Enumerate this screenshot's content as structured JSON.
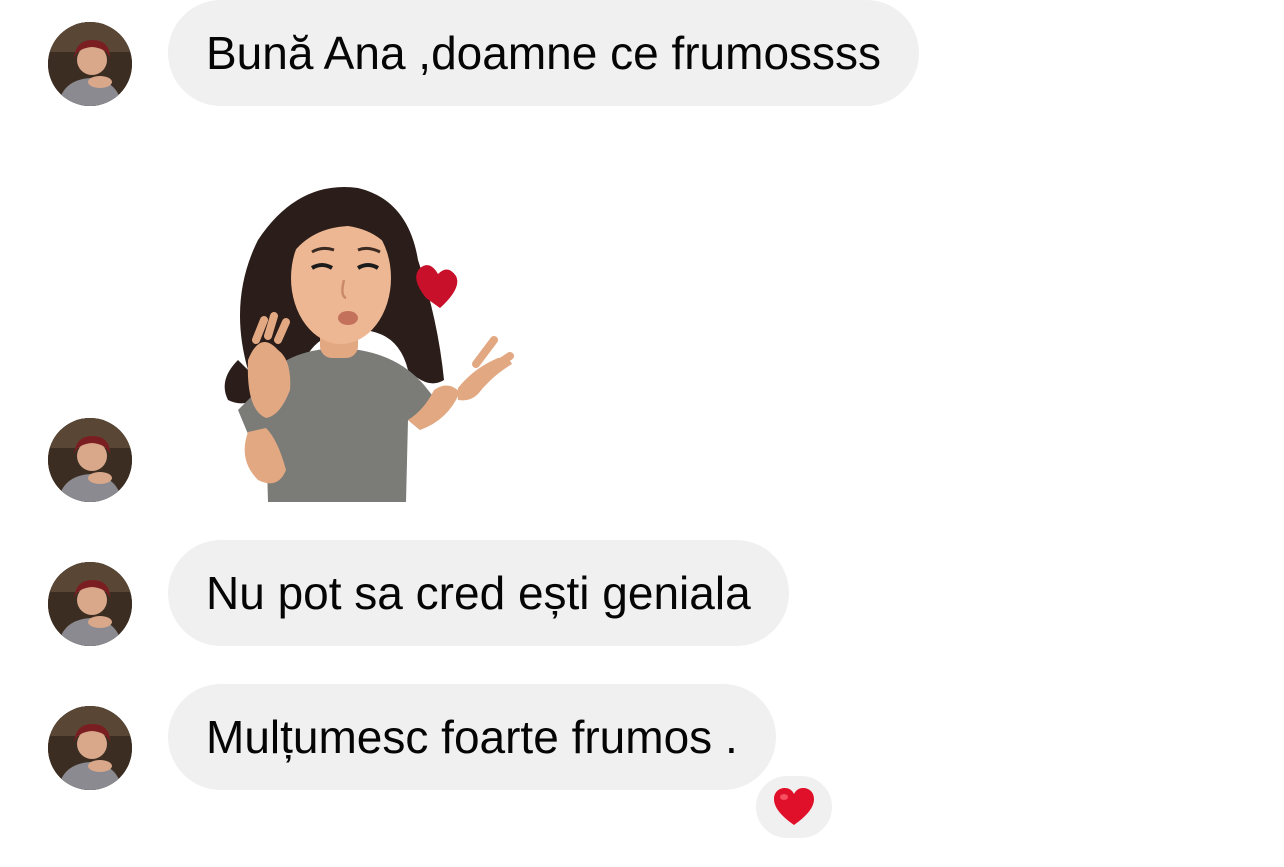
{
  "messages": [
    {
      "type": "text",
      "text": "Bună Ana ,doamne ce frumossss"
    },
    {
      "type": "sticker",
      "sticker": "avatar-blowing-kiss-sticker"
    },
    {
      "type": "text",
      "text": "Nu pot sa cred ești geniala"
    },
    {
      "type": "text",
      "text": "Mulțumesc foarte frumos .",
      "reaction": "heart"
    }
  ],
  "colors": {
    "bubble_background": "#f0f0f0",
    "text": "#050505",
    "reaction_heart": "#e0102a"
  }
}
